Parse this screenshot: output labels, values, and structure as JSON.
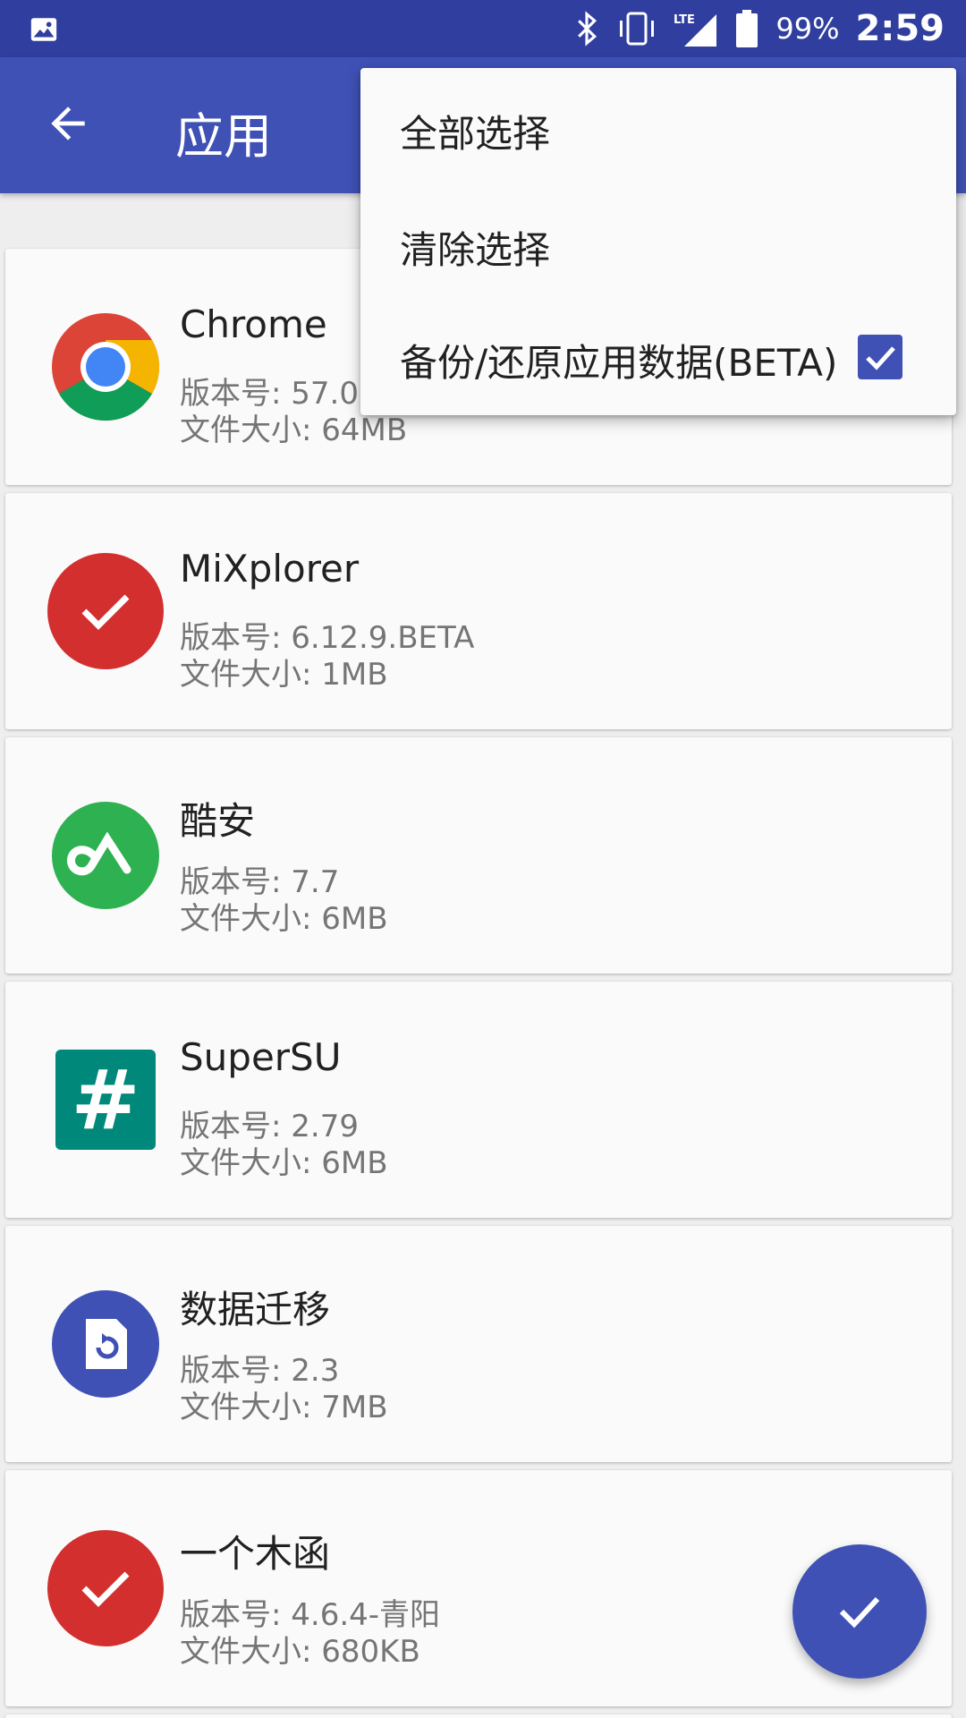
{
  "status_bar": {
    "battery_percent": "99%",
    "time": "2:59",
    "network": "LTE"
  },
  "app_bar": {
    "title": "应用"
  },
  "menu": {
    "items": [
      {
        "label": "全部选择"
      },
      {
        "label": "清除选择"
      },
      {
        "label": "备份/还原应用数据(BETA)",
        "checked": true
      }
    ]
  },
  "apps": [
    {
      "name": "Chrome",
      "version": "版本号: 57.0.",
      "size": "文件大小: 64MB",
      "icon": "chrome-icon"
    },
    {
      "name": "MiXplorer",
      "version": "版本号: 6.12.9.BETA",
      "size": "文件大小: 1MB",
      "icon": "selected-check-icon"
    },
    {
      "name": "酷安",
      "version": "版本号: 7.7",
      "size": "文件大小: 6MB",
      "icon": "coolapk-icon"
    },
    {
      "name": "SuperSU",
      "version": "版本号: 2.79",
      "size": "文件大小: 6MB",
      "icon": "supersu-icon"
    },
    {
      "name": "数据迁移",
      "version": "版本号: 2.3",
      "size": "文件大小: 7MB",
      "icon": "data-migration-icon"
    },
    {
      "name": "一个木函",
      "version": "版本号: 4.6.4-青阳",
      "size": "文件大小: 680KB",
      "icon": "selected-check-icon"
    }
  ],
  "colors": {
    "primary": "#3F51B5",
    "primary_dark": "#303F9F",
    "selected_red": "#D32F2F"
  }
}
